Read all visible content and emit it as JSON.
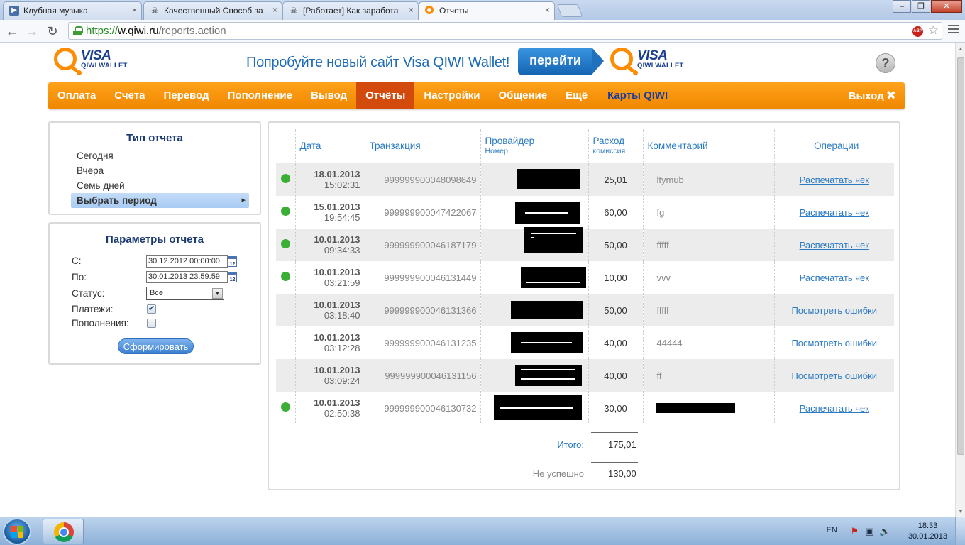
{
  "browser": {
    "tabs": [
      {
        "label": "Клубная музыка",
        "active": false,
        "icon": "play-icon"
      },
      {
        "label": "Качественный Способ за",
        "active": false,
        "icon": "skull-icon"
      },
      {
        "label": "[Работает] Как заработат",
        "active": false,
        "icon": "skull-icon"
      },
      {
        "label": "Отчеты",
        "active": true,
        "icon": "qiwi-icon"
      }
    ],
    "tab_close": "×",
    "url": {
      "scheme": "https://",
      "host": "w.qiwi.ru",
      "path": "/reports.action"
    }
  },
  "header": {
    "logo_visa": "VISA",
    "logo_wallet": "QIWI WALLET",
    "promo_text": "Попробуйте новый сайт Visa QIWI Wallet!",
    "promo_button": "перейти",
    "help": "?"
  },
  "menu": {
    "items": [
      "Оплата",
      "Счета",
      "Перевод",
      "Пополнение",
      "Вывод",
      "Отчёты",
      "Настройки",
      "Общение",
      "Ещё"
    ],
    "active": "Отчёты",
    "cards": "Карты QIWI",
    "exit": "Выход"
  },
  "report_type": {
    "title": "Тип отчета",
    "options": [
      "Сегодня",
      "Вчера",
      "Семь дней",
      "Выбрать период"
    ],
    "selected": "Выбрать период"
  },
  "report_params": {
    "title": "Параметры отчета",
    "from_label": "С:",
    "from_value": "30.12.2012 00:00:00",
    "to_label": "По:",
    "to_value": "30.01.2013 23:59:59",
    "calendar_label": "12",
    "status_label": "Статус:",
    "status_value": "Все",
    "payments_label": "Платежи:",
    "payments_checked": true,
    "topups_label": "Пополнения:",
    "topups_checked": false,
    "submit": "Сформировать"
  },
  "table": {
    "headers": {
      "date": "Дата",
      "transaction": "Транзакция",
      "provider": "Провайдер",
      "provider_sub": "Номер",
      "expense": "Расход",
      "expense_sub": "комиссия",
      "comment": "Комментарий",
      "operations": "Операции"
    },
    "rows": [
      {
        "date": "18.01.2013",
        "time": "15:02:31",
        "txid": "999999900048098649",
        "amount": "25,01",
        "comment": "ltymub",
        "op": "Распечатать чек",
        "success": true
      },
      {
        "date": "15.01.2013",
        "time": "19:54:45",
        "txid": "999999900047422067",
        "amount": "60,00",
        "comment": "fg",
        "op": "Распечатать чек",
        "success": true
      },
      {
        "date": "10.01.2013",
        "time": "09:34:33",
        "txid": "999999900046187179",
        "amount": "50,00",
        "comment": "fffff",
        "op": "Распечатать чек",
        "success": true
      },
      {
        "date": "10.01.2013",
        "time": "03:21:59",
        "txid": "999999900046131449",
        "amount": "10,00",
        "comment": "vvv",
        "op": "Распечатать чек",
        "success": true
      },
      {
        "date": "10.01.2013",
        "time": "03:18:40",
        "txid": "999999900046131366",
        "amount": "50,00",
        "comment": "fffff",
        "op": "Посмотреть ошибки",
        "success": false
      },
      {
        "date": "10.01.2013",
        "time": "03:12:28",
        "txid": "999999900046131235",
        "amount": "40,00",
        "comment": "44444",
        "op": "Посмотреть ошибки",
        "success": false
      },
      {
        "date": "10.01.2013",
        "time": "03:09:24",
        "txid": "999999900046131156",
        "amount": "40,00",
        "comment": "ff",
        "op": "Посмотреть ошибки",
        "success": false
      },
      {
        "date": "10.01.2013",
        "time": "02:50:38",
        "txid": "999999900046130732",
        "amount": "30,00",
        "comment": "",
        "op": "Распечатать чек",
        "success": true
      }
    ],
    "total_label": "Итого:",
    "total_value": "175,01",
    "failed_label": "Не успешно",
    "failed_value": "130,00"
  },
  "taskbar": {
    "lang": "EN",
    "time": "18:33",
    "date": "30.01.2013"
  },
  "colors": {
    "accent": "#f08600",
    "active_menu": "#d24a0c",
    "link": "#2a7ac4",
    "success_dot": "#3cad35"
  }
}
